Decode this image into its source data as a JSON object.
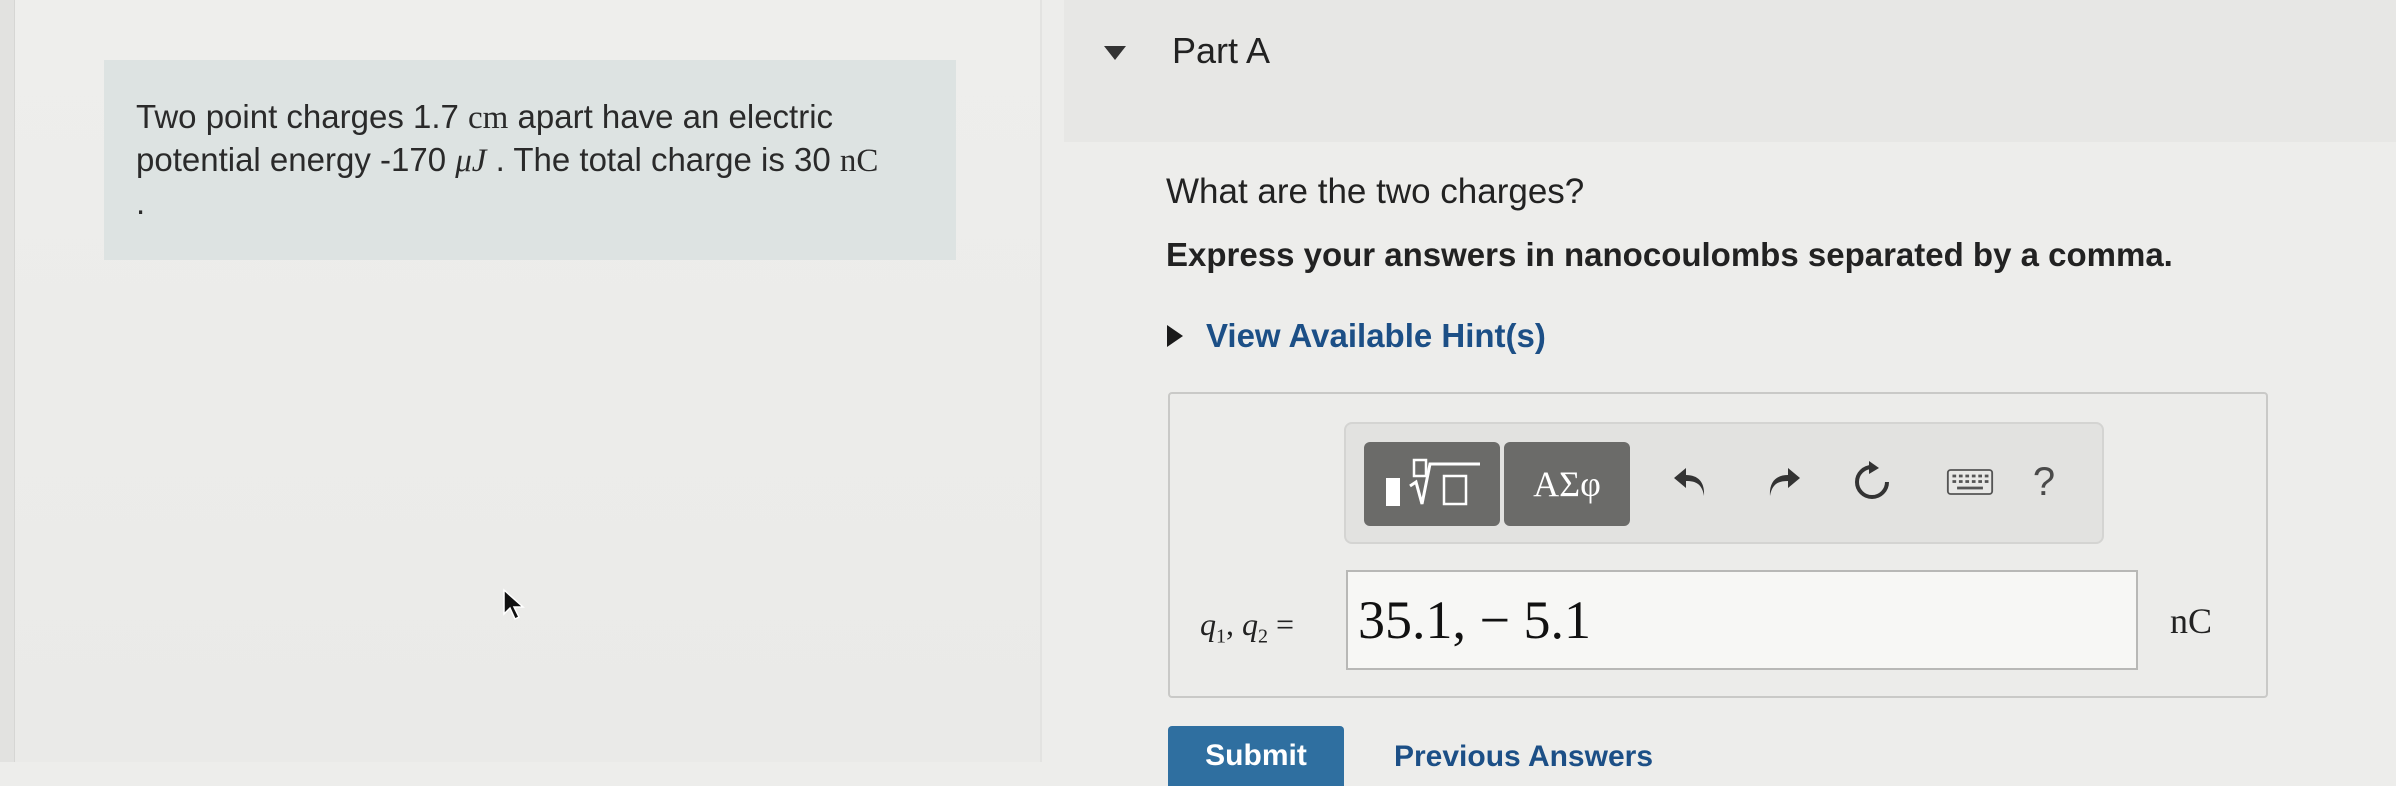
{
  "problem": {
    "text_1": "Two point charges 1.7 ",
    "unit_cm": "cm",
    "text_2": " apart have an electric potential energy -170 ",
    "unit_uJ": "μJ",
    "text_3": " . The total charge is 30 ",
    "unit_nC": "nC",
    "text_4": " ."
  },
  "part": {
    "title": "Part A"
  },
  "question": "What are the two charges?",
  "instruction": "Express your answers in nanocoulombs separated by a comma.",
  "hint_label": "View Available Hint(s)",
  "toolbar": {
    "symbols_label": "ΑΣφ",
    "help_label": "?"
  },
  "answer": {
    "variable_q1": "q",
    "sub1": "1",
    "variable_q2": "q",
    "sub2": "2",
    "equals": "=",
    "value": "35.1, − 5.1",
    "unit": "nC"
  },
  "actions": {
    "submit_label": "Submit",
    "previous_label": "Previous Answers"
  },
  "colors": {
    "link": "#1c4f86",
    "submit_bg": "#2f6fa0",
    "problem_bg": "#dde3e2"
  }
}
